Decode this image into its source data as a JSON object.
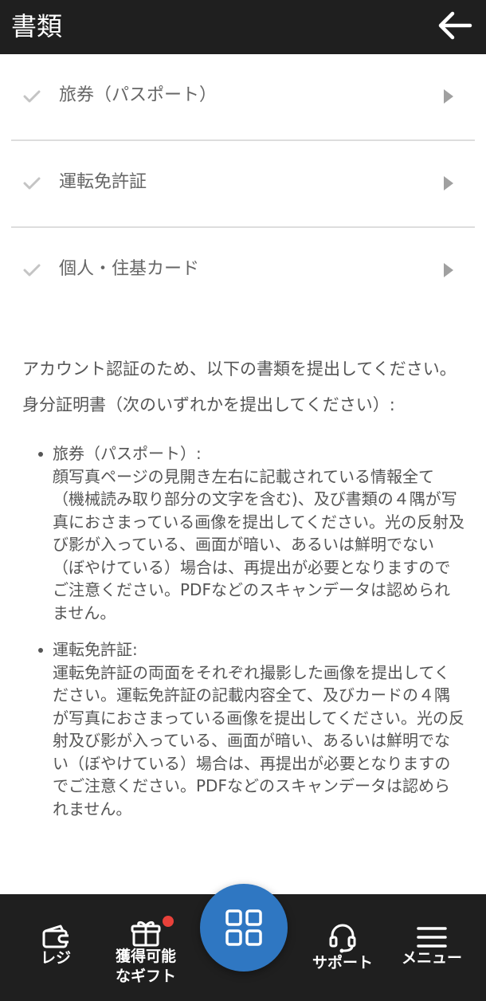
{
  "header": {
    "title": "書類"
  },
  "documents": [
    {
      "label": "旅券（パスポート）"
    },
    {
      "label": "運転免許証"
    },
    {
      "label": "個人・住基カード"
    }
  ],
  "content": {
    "intro": "アカウント認証のため、以下の書類を提出してください。",
    "heading": "身分証明書（次のいずれかを提出してください）:",
    "bullets": [
      {
        "title": "旅券（パスポート）:",
        "body": "顔写真ページの見開き左右に記載されている情報全て（機械読み取り部分の文字を含む)、及び書類の４隅が写真におさまっている画像を提出してください。光の反射及び影が入っている、画面が暗い、あるいは鮮明でない（ぼやけている）場合は、再提出が必要となりますのでご注意ください。PDFなどのスキャンデータは認められません。"
      },
      {
        "title": "運転免許証:",
        "body": "運転免許証の両面をそれぞれ撮影した画像を提出してください。運転免許証の記載内容全て、及びカードの４隅が写真におさまっている画像を提出してください。光の反射及び影が入っている、画面が暗い、あるいは鮮明でない（ぼやけている）場合は、再提出が必要となりますのでご注意ください。PDFなどのスキャンデータは認められません。"
      }
    ]
  },
  "bottom_nav": {
    "register": "レジ",
    "gifts_line1": "獲得可能",
    "gifts_line2": "なギフト",
    "support": "サポート",
    "menu": "メニュー"
  },
  "icons": {
    "back": "arrow-left-icon",
    "check": "check-icon",
    "arrow": "triangle-right-icon",
    "register": "wallet-icon",
    "gifts": "gift-icon",
    "home": "grid-icon",
    "support": "headset-icon",
    "menu": "hamburger-icon"
  },
  "colors": {
    "header_bg": "#1f1f1f",
    "nav_bg": "#1f1f1f",
    "accent_blue": "#2f77c2",
    "notification_red": "#e8413a"
  }
}
